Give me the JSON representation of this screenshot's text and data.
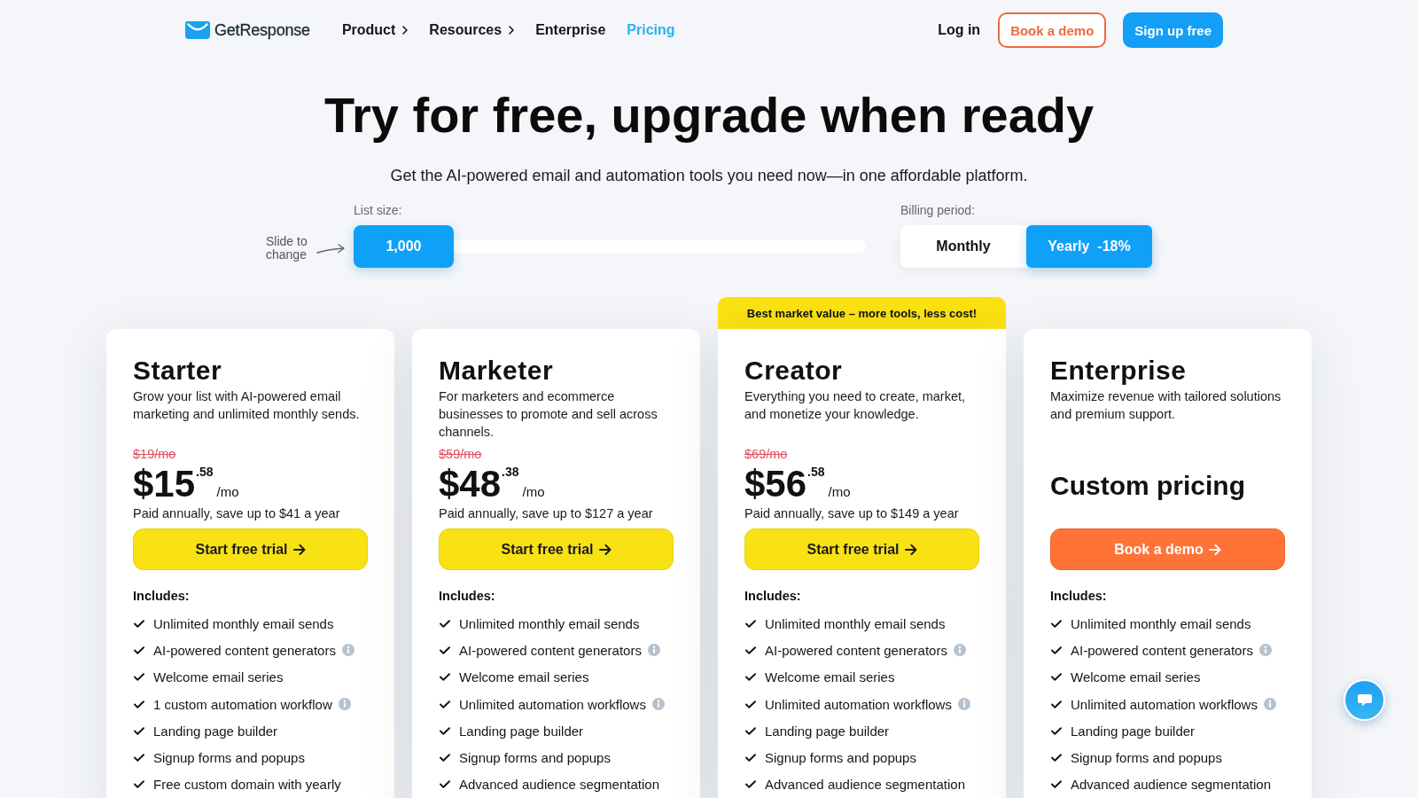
{
  "header": {
    "brand": "GetResponse",
    "links": [
      {
        "label": "Product",
        "has_menu": true,
        "selected": false
      },
      {
        "label": "Resources",
        "has_menu": true,
        "selected": false
      },
      {
        "label": "Enterprise",
        "has_menu": false,
        "selected": false
      },
      {
        "label": "Pricing",
        "has_menu": false,
        "selected": true
      }
    ],
    "login": "Log in",
    "demo_button": "Book a demo",
    "signup_button": "Sign up free"
  },
  "hero": {
    "title": "Try for free, upgrade when ready",
    "subtitle": "Get the AI-powered email and automation tools you need now—in one affordable platform."
  },
  "list_size": {
    "label": "List size:",
    "hint": "Slide to change",
    "value": "1,000",
    "level": 0
  },
  "billing": {
    "label": "Billing period:",
    "options": [
      {
        "label": "Monthly",
        "selected": false
      },
      {
        "label": "Yearly",
        "discount": "-18%",
        "selected": true
      }
    ]
  },
  "plans": [
    {
      "name": "Starter",
      "description": "Grow your list with AI-powered email marketing and unlimited monthly sends.",
      "old_price": "$19/mo",
      "price": "$15",
      "cents": ".58",
      "period": "/mo",
      "note": "Paid annually, save up to $41 a year",
      "button": {
        "label": "Start free trial",
        "kind": "trial"
      },
      "includes_label": "Includes:",
      "features": [
        {
          "label": "Unlimited monthly email sends",
          "info": false
        },
        {
          "label": "AI-powered content generators",
          "info": true
        },
        {
          "label": "Welcome email series",
          "info": false
        },
        {
          "label": "1 custom automation workflow",
          "info": true
        },
        {
          "label": "Landing page builder",
          "info": false
        },
        {
          "label": "Signup forms and popups",
          "info": false
        },
        {
          "label": "Free custom domain with yearly",
          "info": false
        }
      ]
    },
    {
      "name": "Marketer",
      "description": "For marketers and ecommerce businesses to promote and sell across channels.",
      "old_price": "$59/mo",
      "price": "$48",
      "cents": ".38",
      "period": "/mo",
      "note": "Paid annually, save up to $127 a year",
      "button": {
        "label": "Start free trial",
        "kind": "trial"
      },
      "includes_label": "Includes:",
      "features": [
        {
          "label": "Unlimited monthly email sends",
          "info": false
        },
        {
          "label": "AI-powered content generators",
          "info": true
        },
        {
          "label": "Welcome email series",
          "info": false
        },
        {
          "label": "Unlimited automation workflows",
          "info": true
        },
        {
          "label": "Landing page builder",
          "info": false
        },
        {
          "label": "Signup forms and popups",
          "info": false
        },
        {
          "label": "Advanced audience segmentation",
          "info": false
        }
      ]
    },
    {
      "name": "Creator",
      "badge": "Best market value – more tools, less cost!",
      "description": "Everything you need to create, market, and monetize your knowledge.",
      "old_price": "$69/mo",
      "price": "$56",
      "cents": ".58",
      "period": "/mo",
      "note": "Paid annually, save up to $149 a year",
      "button": {
        "label": "Start free trial",
        "kind": "trial"
      },
      "includes_label": "Includes:",
      "features": [
        {
          "label": "Unlimited monthly email sends",
          "info": false
        },
        {
          "label": "AI-powered content generators",
          "info": true
        },
        {
          "label": "Welcome email series",
          "info": false
        },
        {
          "label": "Unlimited automation workflows",
          "info": true
        },
        {
          "label": "Landing page builder",
          "info": false
        },
        {
          "label": "Signup forms and popups",
          "info": false
        },
        {
          "label": "Advanced audience segmentation",
          "info": false
        }
      ]
    },
    {
      "name": "Enterprise",
      "description": "Maximize revenue with tailored solutions and premium support.",
      "custom_price": "Custom pricing",
      "button": {
        "label": "Book a demo",
        "kind": "demo"
      },
      "includes_label": "Includes:",
      "features": [
        {
          "label": "Unlimited monthly email sends",
          "info": false
        },
        {
          "label": "AI-powered content generators",
          "info": true
        },
        {
          "label": "Welcome email series",
          "info": false
        },
        {
          "label": "Unlimited automation workflows",
          "info": true
        },
        {
          "label": "Landing page builder",
          "info": false
        },
        {
          "label": "Signup forms and popups",
          "info": false
        },
        {
          "label": "Advanced audience segmentation",
          "info": false
        }
      ]
    }
  ]
}
